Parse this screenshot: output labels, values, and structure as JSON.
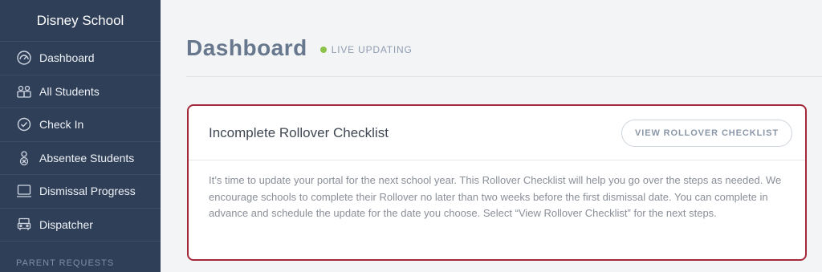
{
  "sidebar": {
    "school_name": "Disney School",
    "items": [
      {
        "label": "Dashboard",
        "icon": "speedometer-icon"
      },
      {
        "label": "All Students",
        "icon": "students-icon"
      },
      {
        "label": "Check In",
        "icon": "check-circle-icon"
      },
      {
        "label": "Absentee Students",
        "icon": "absentee-icon"
      },
      {
        "label": "Dismissal Progress",
        "icon": "monitor-icon"
      },
      {
        "label": "Dispatcher",
        "icon": "car-icon"
      }
    ],
    "section_label": "PARENT REQUESTS"
  },
  "header": {
    "title": "Dashboard",
    "live_status": "LIVE UPDATING",
    "live_color": "#8bc34a"
  },
  "card": {
    "title": "Incomplete Rollover Checklist",
    "button_label": "VIEW ROLLOVER CHECKLIST",
    "body": "It’s time to update your portal for the next school year. This Rollover Checklist will help you go over the steps as needed. We encourage schools to complete their Rollover no later than two weeks before the first dismissal date. You can complete in advance and schedule the update for the date you choose. Select “View Rollover Checklist” for the next steps.",
    "border_color": "#a3283a"
  }
}
